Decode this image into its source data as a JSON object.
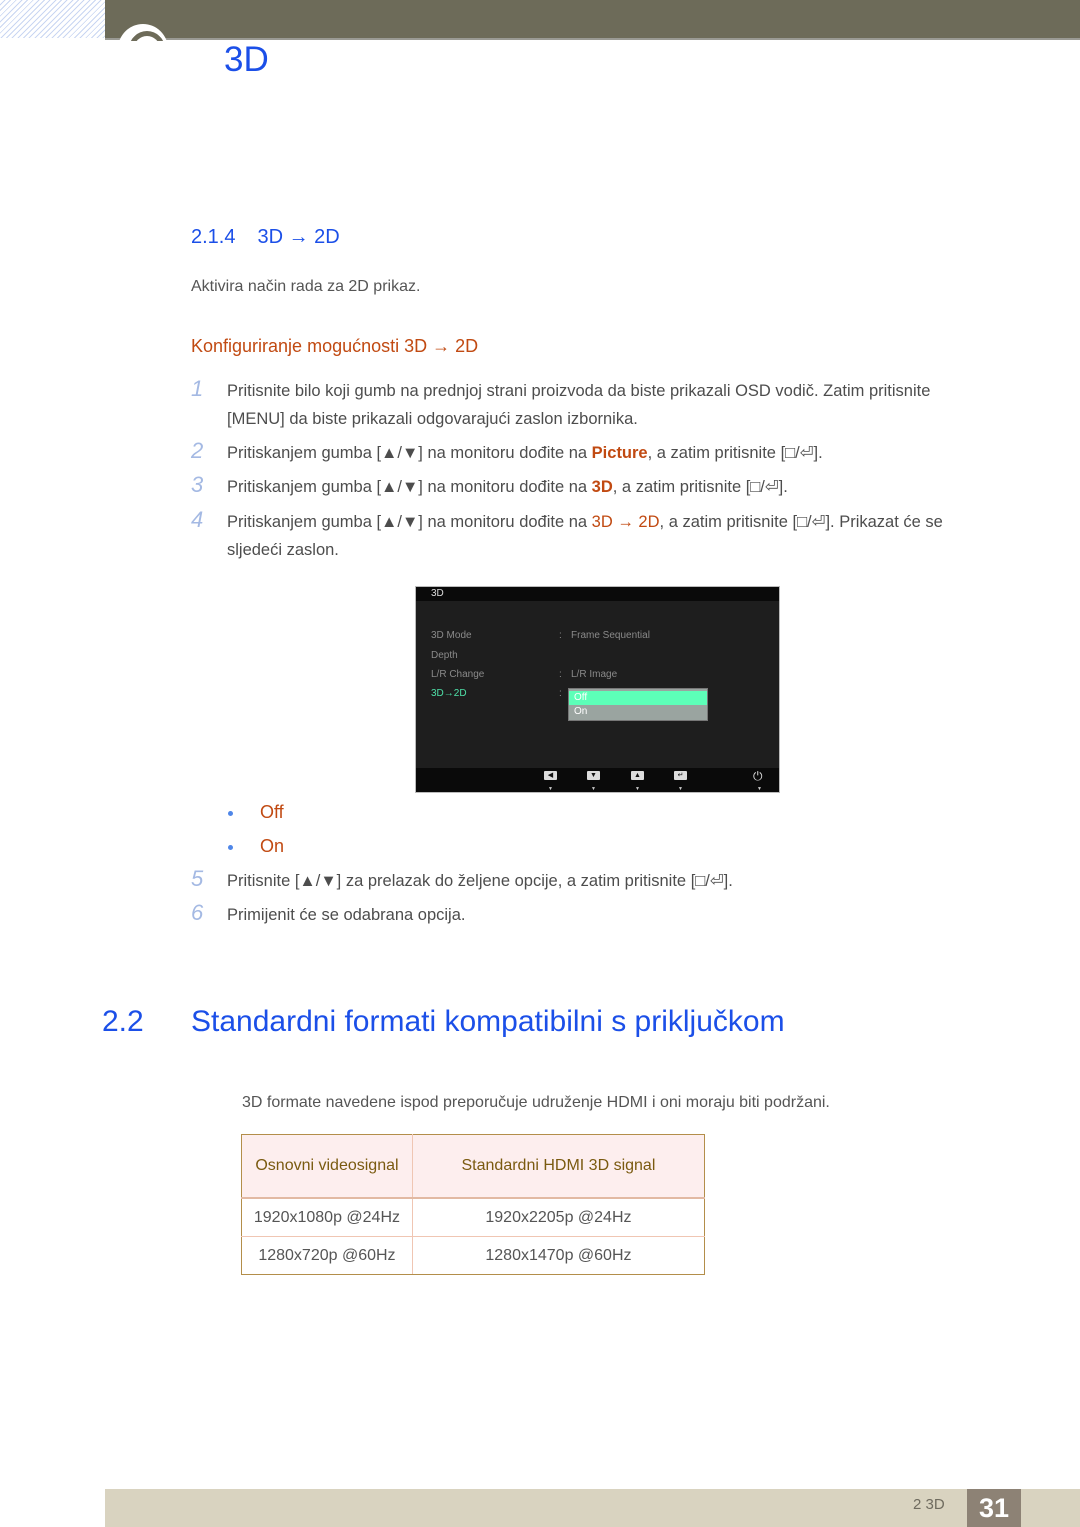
{
  "header": {
    "chapter_number": "2",
    "chapter_title": "3D"
  },
  "section_214": {
    "number": "2.1.4",
    "title": "3D → 2D",
    "intro": "Aktivira način rada za 2D prikaz.",
    "subheading": "Konfiguriranje mogućnosti 3D → 2D"
  },
  "steps": [
    {
      "n": "1",
      "parts": [
        "Pritisnite bilo koji gumb na prednjoj strani proizvoda da biste prikazali OSD vodič. Zatim pritisnite",
        "[MENU] da biste prikazali odgovarajući zaslon izbornika."
      ]
    },
    {
      "n": "2",
      "pre": "Pritiskanjem gumba [▲/▼] na monitoru dođite na ",
      "hl": "Picture",
      "post": ", a zatim pritisnite [□/⏎]."
    },
    {
      "n": "3",
      "pre": "Pritiskanjem gumba [▲/▼] na monitoru dođite na ",
      "hl": "3D",
      "post": ", a zatim pritisnite [□/⏎]."
    },
    {
      "n": "4",
      "pre": "Pritiskanjem gumba [▲/▼] na monitoru dođite na ",
      "hl": "3D → 2D",
      "post": ", a zatim pritisnite [□/⏎]. Prikazat će se",
      "line2": "sljedeći zaslon."
    },
    {
      "n": "5",
      "text": "Pritisnite [▲/▼] za prelazak do željene opcije, a zatim pritisnite [□/⏎]."
    },
    {
      "n": "6",
      "text": "Primijenit će se odabrana opcija."
    }
  ],
  "osd": {
    "title": "3D",
    "rows": [
      {
        "label": "3D Mode",
        "value": "Frame Sequential"
      },
      {
        "label": "Depth",
        "value": ""
      },
      {
        "label": "L/R Change",
        "value": "L/R Image"
      },
      {
        "label": "3D→2D",
        "value": ""
      }
    ],
    "dropdown_options": [
      "Off",
      "On"
    ],
    "selected_option": "Off",
    "footer_buttons": [
      "◀",
      "▼",
      "▲",
      "↵",
      "⏻"
    ]
  },
  "options": [
    "Off",
    "On"
  ],
  "section_22": {
    "number": "2.2",
    "title": "Standardni formati kompatibilni s priključkom",
    "note": "3D formate navedene ispod preporučuje udruženje HDMI i oni moraju biti podržani."
  },
  "table": {
    "headers": [
      "Osnovni videosignal",
      "Standardni HDMI 3D signal"
    ],
    "rows": [
      [
        "1920x1080p @24Hz",
        "1920x2205p @24Hz"
      ],
      [
        "1280x720p @60Hz",
        "1280x1470p @60Hz"
      ]
    ]
  },
  "footer": {
    "section_label": "2 3D",
    "page_number": "31"
  }
}
